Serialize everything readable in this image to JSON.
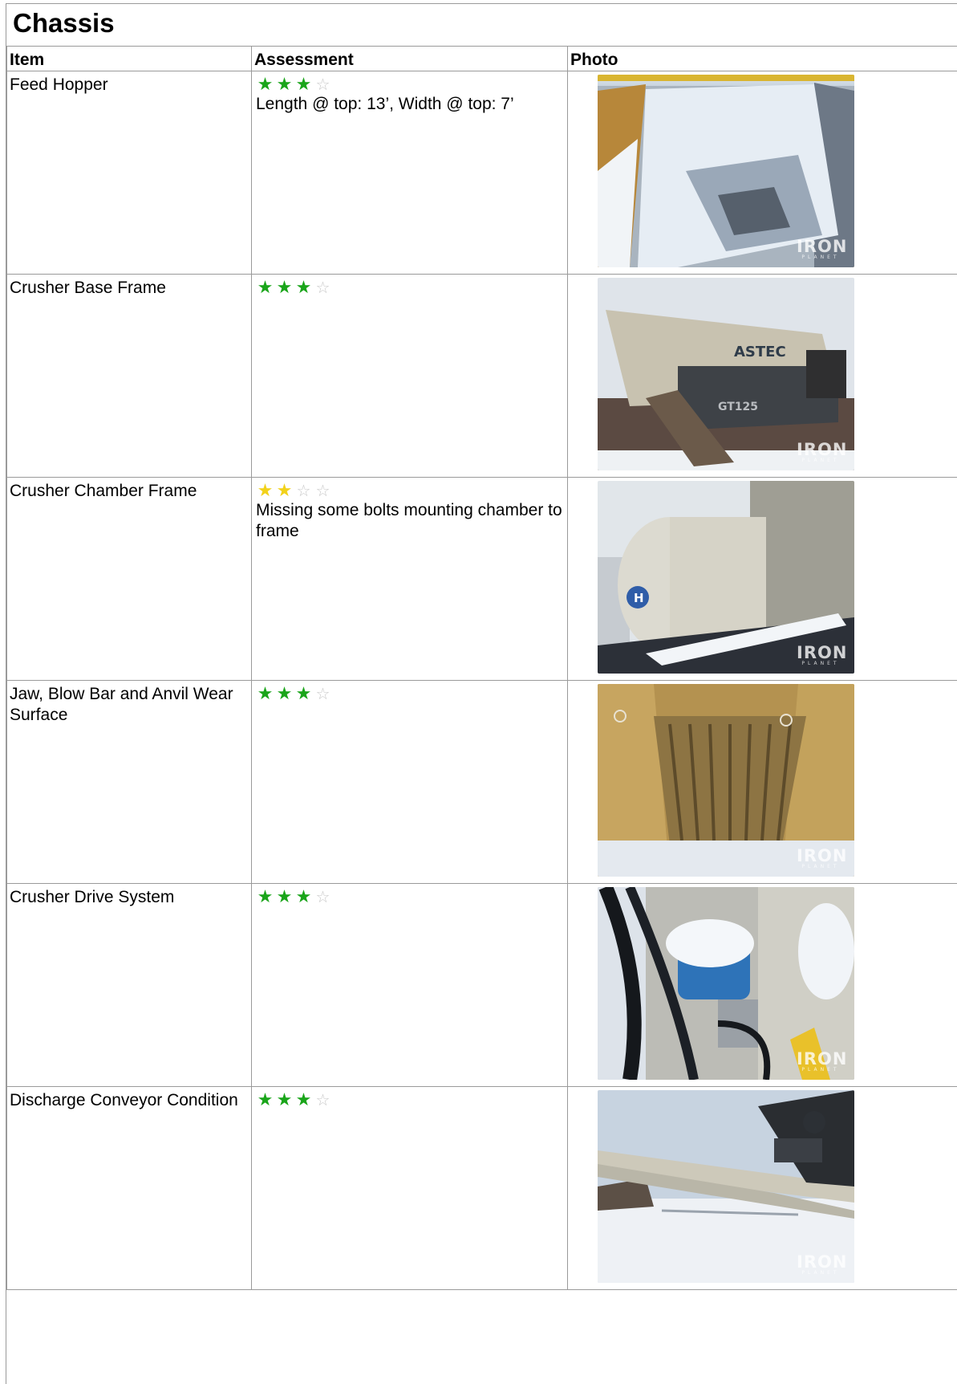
{
  "section": {
    "title": "Chassis"
  },
  "columns": {
    "item": "Item",
    "assessment": "Assessment",
    "photo": "Photo"
  },
  "watermark": {
    "line1": "IRON",
    "line2": "PLANET"
  },
  "rows": [
    {
      "item": "Feed Hopper",
      "rating": 3,
      "max": 4,
      "color": "#1aa51a",
      "note": "Length @ top: 13’, Width @ top: 7’"
    },
    {
      "item": "Crusher Base Frame",
      "rating": 3,
      "max": 4,
      "color": "#1aa51a",
      "note": "",
      "photo_text": {
        "brand": "ASTEC",
        "model": "GT125"
      }
    },
    {
      "item": "Crusher Chamber Frame",
      "rating": 2,
      "max": 4,
      "color": "#f2d21a",
      "note": "Missing some bolts mounting chamber to frame",
      "photo_text": {
        "logo": "H"
      }
    },
    {
      "item": "Jaw, Blow Bar and Anvil Wear Surface",
      "rating": 3,
      "max": 4,
      "color": "#1aa51a",
      "note": ""
    },
    {
      "item": "Crusher Drive System",
      "rating": 3,
      "max": 4,
      "color": "#1aa51a",
      "note": ""
    },
    {
      "item": "Discharge Conveyor Condition",
      "rating": 3,
      "max": 4,
      "color": "#1aa51a",
      "note": ""
    }
  ]
}
